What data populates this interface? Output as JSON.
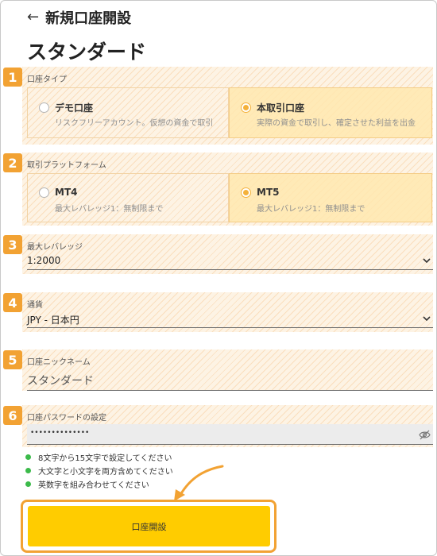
{
  "header": {
    "back_icon": "arrow-left-icon",
    "title": "新規口座開設"
  },
  "page_title": "スタンダード",
  "accent_color": "#f2a233",
  "sections": {
    "account_type": {
      "number": "1",
      "label": "口座タイプ",
      "options": [
        {
          "title": "デモ口座",
          "desc": "リスクフリーアカウント。仮想の資金で取引",
          "selected": false
        },
        {
          "title": "本取引口座",
          "desc": "実際の資金で取引し、確定させた利益を出金",
          "selected": true
        }
      ]
    },
    "platform": {
      "number": "2",
      "label": "取引プラットフォーム",
      "options": [
        {
          "title": "MT4",
          "desc": "最大レバレッジ1：無制限まで",
          "selected": false
        },
        {
          "title": "MT5",
          "desc": "最大レバレッジ1：無制限まで",
          "selected": true
        }
      ]
    },
    "leverage": {
      "number": "3",
      "label": "最大レバレッジ",
      "value": "1:2000"
    },
    "currency": {
      "number": "4",
      "label": "通貨",
      "value": "JPY - 日本円"
    },
    "nickname": {
      "number": "5",
      "label": "口座ニックネーム",
      "value": "スタンダード"
    },
    "password": {
      "number": "6",
      "label": "口座パスワードの設定",
      "value": "••••••••••••••"
    }
  },
  "password_rules": [
    "8文字から15文字で設定してください",
    "大文字と小文字を両方含めてください",
    "英数字を組み合わせてください"
  ],
  "submit_label": "口座開設"
}
